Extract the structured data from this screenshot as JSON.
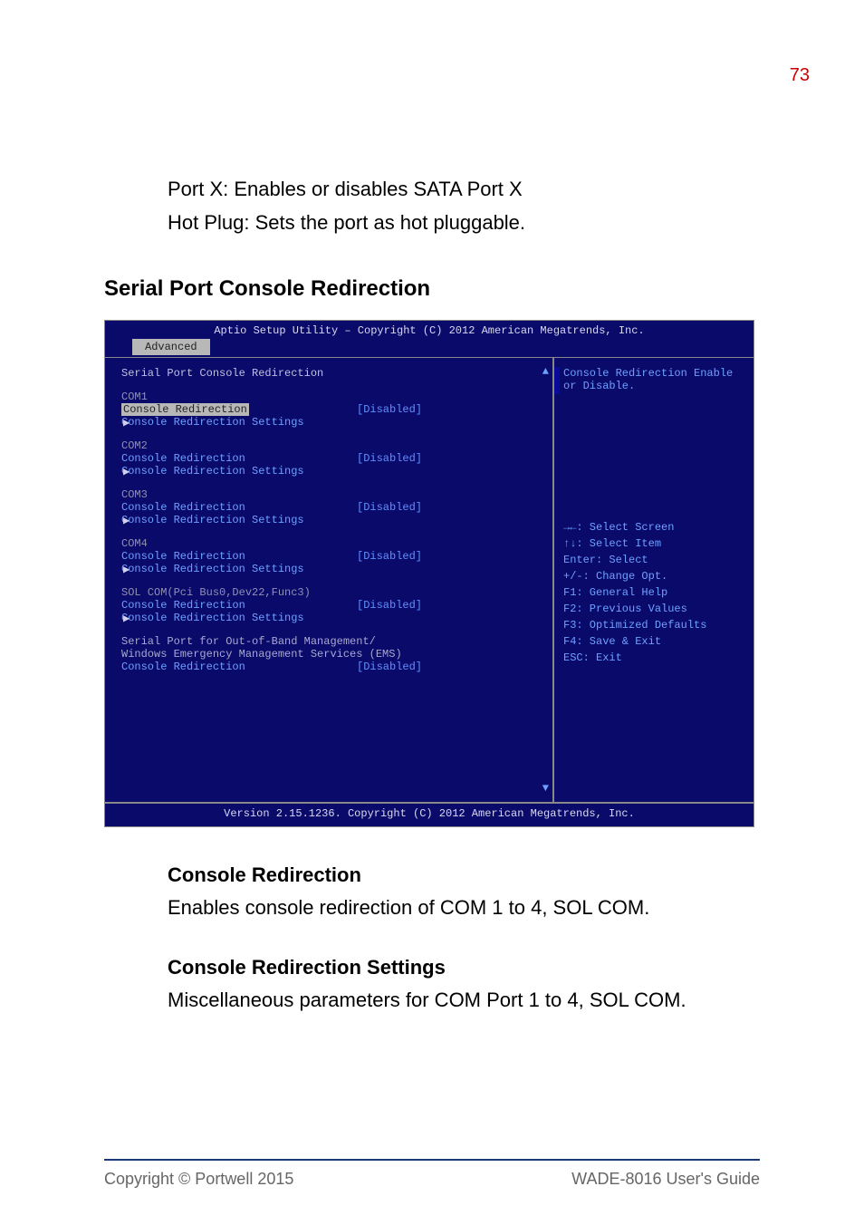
{
  "page_number_top": "73",
  "intro_lines": [
    "Port X: Enables or disables SATA Port X",
    "Hot Plug: Sets the port as hot pluggable."
  ],
  "section_heading": "Serial Port Console Redirection",
  "bios": {
    "titlebar": "Aptio Setup Utility – Copyright (C) 2012 American Megatrends, Inc.",
    "tab": "Advanced",
    "left_title": "Serial Port Console Redirection",
    "groups": [
      {
        "name": "COM1",
        "redir_label": "Console Redirection",
        "redir_value": "[Disabled]",
        "settings": "Console Redirection Settings",
        "highlighted": true
      },
      {
        "name": "COM2",
        "redir_label": "Console Redirection",
        "redir_value": "[Disabled]",
        "settings": "Console Redirection Settings",
        "highlighted": false
      },
      {
        "name": "COM3",
        "redir_label": "Console Redirection",
        "redir_value": "[Disabled]",
        "settings": "Console Redirection Settings",
        "highlighted": false
      },
      {
        "name": "COM4",
        "redir_label": "Console Redirection",
        "redir_value": "[Disabled]",
        "settings": "Console Redirection Settings",
        "highlighted": false
      },
      {
        "name": "SOL COM(Pci Bus0,Dev22,Func3)",
        "redir_label": "Console Redirection",
        "redir_value": "[Disabled]",
        "settings": "Console Redirection Settings",
        "highlighted": false
      }
    ],
    "oob_line1": "Serial Port for Out-of-Band Management/",
    "oob_line2": "Windows Emergency Management Services (EMS)",
    "oob_redir_label": "Console Redirection",
    "oob_redir_value": "[Disabled]",
    "help_text": "Console Redirection Enable or Disable.",
    "keys": [
      "→←: Select Screen",
      "↑↓: Select Item",
      "Enter: Select",
      "+/-: Change Opt.",
      "F1: General Help",
      "F2: Previous Values",
      "F3: Optimized Defaults",
      "F4: Save & Exit",
      "ESC: Exit"
    ],
    "footer": "Version 2.15.1236. Copyright (C) 2012 American Megatrends, Inc."
  },
  "sub1_heading": "Console Redirection",
  "sub1_body": "Enables console redirection of COM 1 to 4, SOL COM.",
  "sub2_heading": "Console Redirection Settings",
  "sub2_body": "Miscellaneous parameters for COM Port 1 to 4, SOL COM.",
  "footer_left": "Copyright © Portwell 2015",
  "footer_right": "WADE-8016 User's Guide"
}
